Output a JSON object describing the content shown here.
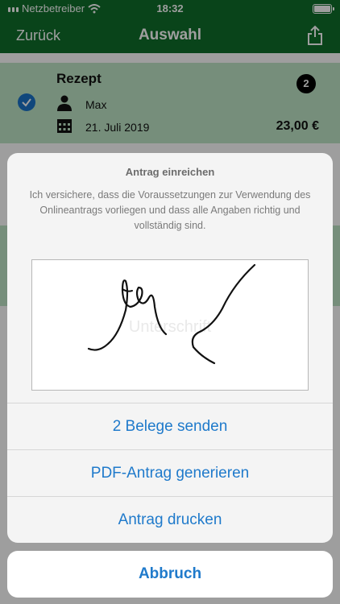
{
  "status_bar": {
    "carrier": "Netzbetreiber",
    "time": "18:32"
  },
  "nav": {
    "back_label": "Zurück",
    "title": "Auswahl",
    "share_icon": "share-icon"
  },
  "receipt": {
    "title": "Rezept",
    "person": "Max",
    "date": "21. Juli 2019",
    "count": "2",
    "amount": "23,00 €",
    "selected": true
  },
  "sheet": {
    "title": "Antrag einreichen",
    "message": "Ich versichere, dass die Voraussetzungen zur Verwendung des Onlineantrags vorliegen und dass alle Angaben richtig und vollständig sind.",
    "signature_placeholder": "Unterschrift",
    "actions": [
      "2 Belege senden",
      "PDF-Antrag generieren",
      "Antrag drucken"
    ],
    "cancel_label": "Abbruch"
  },
  "colors": {
    "header_green": "#0f6e2b",
    "card_green": "#bfe5c7",
    "action_blue": "#1f7acb",
    "check_blue": "#1a73c9"
  }
}
